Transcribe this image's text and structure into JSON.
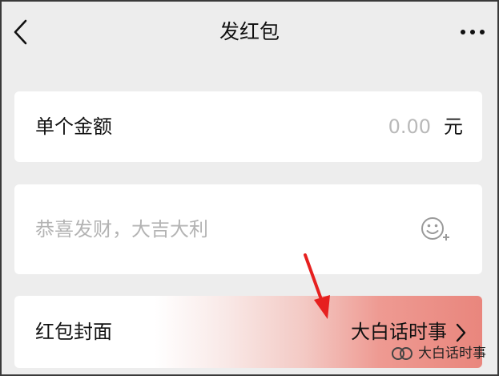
{
  "header": {
    "title": "发红包",
    "back_icon": "chevron-left-icon",
    "more_icon": "more-dots-icon"
  },
  "amount_card": {
    "label": "单个金额",
    "value": "0.00",
    "unit": "元"
  },
  "greeting_card": {
    "placeholder": "恭喜发财，大吉大利",
    "emoji_icon": "emoji-add-icon"
  },
  "cover_card": {
    "label": "红包封面",
    "value": "大白话时事",
    "chevron_icon": "chevron-right-icon"
  },
  "watermark": {
    "text": "大白话时事",
    "icon": "wechat-channel-icon"
  },
  "colors": {
    "background": "#ededed",
    "card": "#ffffff",
    "placeholder": "#b3b3b3",
    "annotation_arrow": "#e6201f"
  }
}
